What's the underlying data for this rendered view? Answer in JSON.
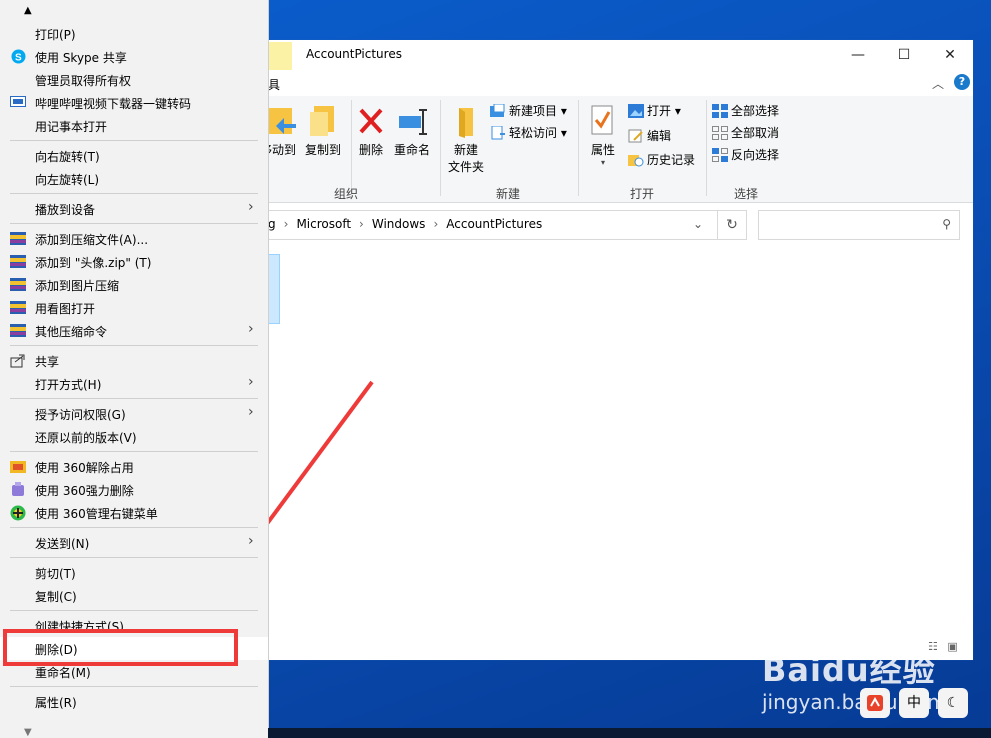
{
  "window": {
    "title": "AccountPictures",
    "ribbon_tab_partial": "具",
    "caption": {
      "minimize": "—",
      "maximize": "☐",
      "close": "✕"
    },
    "help": "?",
    "collapse_ribbon": "︿"
  },
  "ribbon": {
    "move_to": "移动到",
    "copy_to": "复制到",
    "delete": "删除",
    "rename": "重命名",
    "new_folder_line1": "新建",
    "new_folder_line2": "文件夹",
    "new_item": "新建项目 ▾",
    "easy_access": "轻松访问 ▾",
    "properties": "属性",
    "open": "打开 ▾",
    "edit": "编辑",
    "history": "历史记录",
    "select_all": "全部选择",
    "select_none": "全部取消",
    "invert_selection": "反向选择",
    "groups": {
      "organize": "组织",
      "new": "新建",
      "open": "打开",
      "select": "选择"
    }
  },
  "address": {
    "crumbs": [
      "g",
      "Microsoft",
      "Windows",
      "AccountPictures"
    ],
    "dropdown": "⌄",
    "refresh": "↻",
    "search_icon": "⚲"
  },
  "context_menu": {
    "scroll_up": "▲",
    "scroll_down": "▼",
    "items": [
      {
        "label": "打印(P)"
      },
      {
        "label": "使用 Skype 共享",
        "icon": "skype-icon"
      },
      {
        "label": "管理员取得所有权"
      },
      {
        "label": "哔哩哔哩视频下载器一键转码",
        "icon": "bilibili-icon"
      },
      {
        "label": "用记事本打开"
      },
      {
        "label": "向右旋转(T)"
      },
      {
        "label": "向左旋转(L)"
      },
      {
        "label": "播放到设备",
        "submenu": true
      },
      {
        "label": "添加到压缩文件(A)...",
        "icon": "winrar-icon"
      },
      {
        "label": "添加到 \"头像.zip\" (T)",
        "icon": "winrar-icon"
      },
      {
        "label": "添加到图片压缩",
        "icon": "winrar-icon"
      },
      {
        "label": "用看图打开",
        "icon": "winrar-icon"
      },
      {
        "label": "其他压缩命令",
        "icon": "winrar-icon",
        "submenu": true
      },
      {
        "label": "共享",
        "icon": "share-icon"
      },
      {
        "label": "打开方式(H)",
        "submenu": true
      },
      {
        "label": "授予访问权限(G)",
        "submenu": true
      },
      {
        "label": "还原以前的版本(V)"
      },
      {
        "label": "使用 360解除占用",
        "icon": "360-unlock-icon"
      },
      {
        "label": "使用 360强力删除",
        "icon": "360-delete-icon"
      },
      {
        "label": "使用 360管理右键菜单",
        "icon": "360-menu-icon"
      },
      {
        "label": "发送到(N)",
        "submenu": true
      },
      {
        "label": "剪切(T)"
      },
      {
        "label": "复制(C)"
      },
      {
        "label": "创建快捷方式(S)"
      },
      {
        "label": "删除(D)",
        "highlighted": true
      },
      {
        "label": "重命名(M)"
      },
      {
        "label": "属性(R)"
      }
    ]
  },
  "watermark": {
    "brand": "Baidu经验",
    "url": "jingyan.baidu.com"
  },
  "tray": {
    "ime": "中",
    "moon": "☾"
  }
}
